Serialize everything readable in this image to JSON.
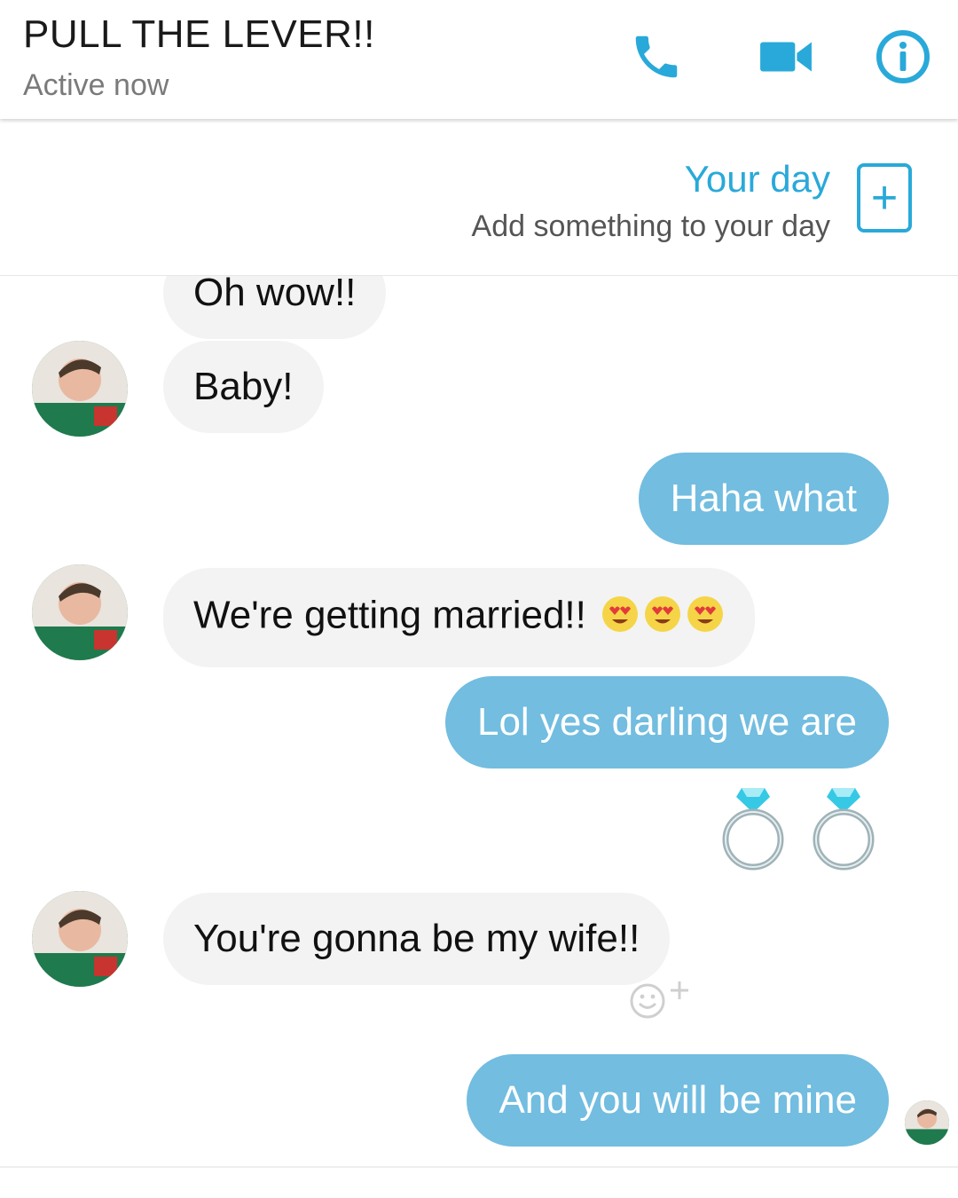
{
  "header": {
    "title": "PULL THE LEVER!!",
    "status": "Active now",
    "icons": [
      "phone-icon",
      "video-camera-icon",
      "info-icon"
    ],
    "accent_color": "#29a9d9"
  },
  "your_day": {
    "title": "Your day",
    "subtitle": "Add something to your day",
    "add_symbol": "+"
  },
  "messages": [
    {
      "side": "incoming",
      "text": "Oh wow!!"
    },
    {
      "side": "incoming",
      "text": "Baby!"
    },
    {
      "side": "outgoing",
      "text": "Haha what"
    },
    {
      "side": "incoming",
      "text": "We're getting married!!",
      "emoji": [
        "heart-eyes-emoji",
        "heart-eyes-emoji",
        "heart-eyes-emoji"
      ]
    },
    {
      "side": "outgoing",
      "text": "Lol yes darling we are"
    },
    {
      "side": "outgoing",
      "emoji": [
        "ring-emoji",
        "ring-emoji"
      ]
    },
    {
      "side": "incoming",
      "text": "You're gonna be my wife!!"
    },
    {
      "side": "outgoing",
      "text": "And you will be mine"
    }
  ],
  "colors": {
    "outgoing_bubble": "#72bde0",
    "incoming_bubble": "#f3f3f3"
  }
}
